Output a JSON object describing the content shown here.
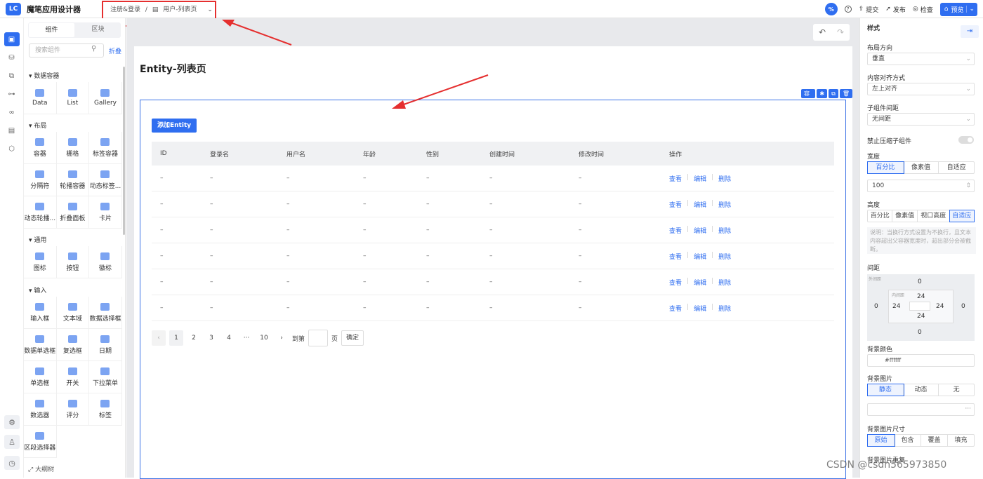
{
  "topbar": {
    "logo": "LC",
    "app_title": "魔笔应用设计器",
    "breadcrumb_root": "注册&登录",
    "breadcrumb_sep": "/",
    "breadcrumb_page": "用户-列表页",
    "percent": "%",
    "help": "?",
    "submit": "提交",
    "publish": "发布",
    "check": "检查",
    "preview": "预览"
  },
  "left": {
    "tab_components": "组件",
    "tab_blocks": "区块",
    "search_placeholder": "搜索组件",
    "fold": "折叠",
    "categories": [
      "数据容器",
      "布局",
      "通用",
      "输入"
    ],
    "data_container": [
      "Data",
      "List",
      "Gallery"
    ],
    "layout": [
      "容器",
      "栅格",
      "标签容器",
      "分隔符",
      "轮播容器",
      "动态标签...",
      "动态轮播...",
      "折叠面板",
      "卡片"
    ],
    "general": [
      "图标",
      "按钮",
      "徽标"
    ],
    "input": [
      "输入框",
      "文本域",
      "数据选择框",
      "数据单选框",
      "复选框",
      "日期",
      "单选框",
      "开关",
      "下拉菜单",
      "数选器",
      "评分",
      "标签",
      "区段选择器"
    ],
    "outline": "大纲树"
  },
  "canvas": {
    "page_title": "Entity-列表页",
    "ctr_label": "容器",
    "add_button": "添加Entity",
    "columns": [
      "ID",
      "登录名",
      "用户名",
      "年龄",
      "性别",
      "创建时间",
      "修改时间",
      "操作"
    ],
    "row_cell": "–",
    "rows": 6,
    "actions": [
      "查看",
      "编辑",
      "删除"
    ],
    "pagination": {
      "pages": [
        "1",
        "2",
        "3",
        "4",
        "···",
        "10"
      ],
      "current": "1",
      "goto_label": "到第",
      "page_unit": "页",
      "confirm": "确定"
    }
  },
  "right": {
    "title": "样式",
    "layout_dir_label": "布局方向",
    "layout_dir_value": "垂直",
    "align_label": "内容对齐方式",
    "align_value": "左上对齐",
    "gap_label": "子组件间距",
    "gap_value": "无间距",
    "no_shrink_label": "禁止压缩子组件",
    "width_label": "宽度",
    "width_options": [
      "百分比",
      "像素值",
      "自适应"
    ],
    "width_value": "100",
    "height_label": "高度",
    "height_options": [
      "百分比",
      "像素值",
      "视口高度",
      "自适应"
    ],
    "note": "说明：当换行方式设置为不换行，且文本内容超出父容器宽度时，超出部分会被截断。",
    "spacing_label": "间距",
    "outer_label": "外间距",
    "inner_label": "内间距",
    "margin_top": "0",
    "margin_left": "0",
    "margin_right": "0",
    "margin_bottom": "0",
    "padding_top": "24",
    "padding_left": "24",
    "padding_right": "24",
    "padding_bottom": "24",
    "bg_color_label": "背景颜色",
    "bg_color_value": "#ffffff",
    "bg_image_label": "背景图片",
    "bg_image_options": [
      "静态",
      "动态",
      "无"
    ],
    "bg_image_more": "···",
    "bg_size_label": "背景图片尺寸",
    "bg_size_options": [
      "原始",
      "包含",
      "覆盖",
      "填充"
    ],
    "bg_repeat_label": "背景图片重复"
  },
  "watermark": "CSDN @csdn565973850",
  "colors": {
    "accent": "#2f6ef0",
    "annotation_red": "#e52f2f"
  }
}
